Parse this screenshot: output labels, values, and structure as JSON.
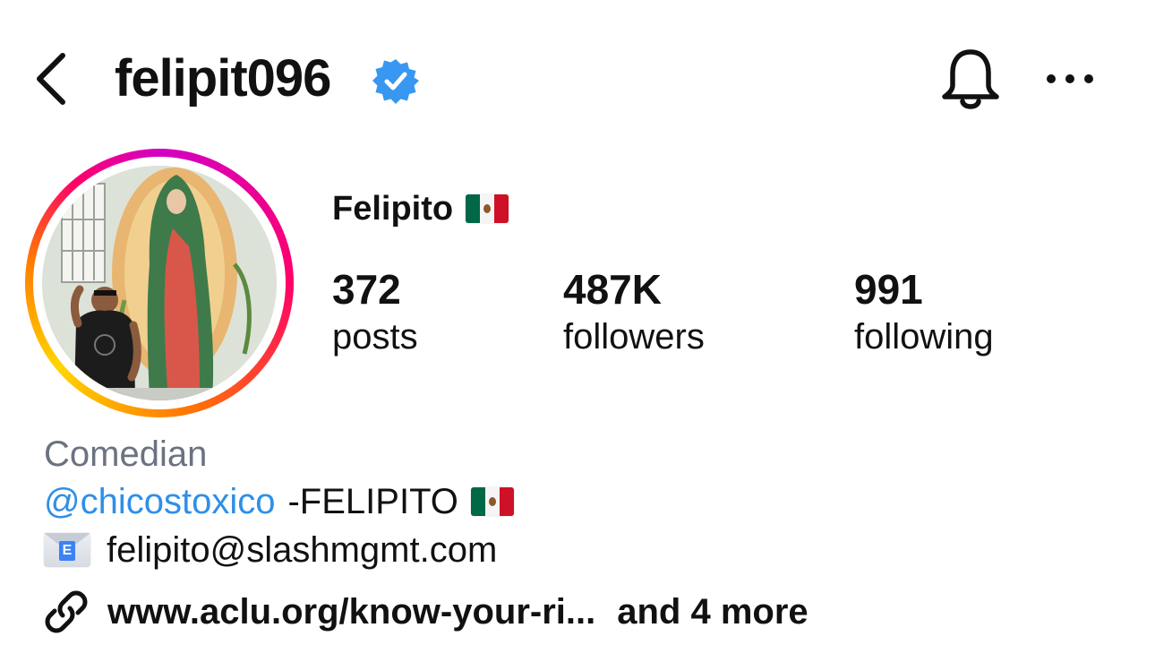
{
  "header": {
    "back_icon": "chevron-left-icon",
    "handle": "felipit096",
    "verified_icon": "verified-badge-icon",
    "verified_color": "#3897f0",
    "notifications_icon": "bell-icon",
    "more_icon": "ellipsis-icon"
  },
  "profile": {
    "avatar_has_story": true,
    "display_name": "Felipito",
    "flag_icon": "mexico-flag-icon"
  },
  "stats": [
    {
      "value": "372",
      "label": "posts"
    },
    {
      "value": "487K",
      "label": "followers"
    },
    {
      "value": "991",
      "label": "following"
    }
  ],
  "bio": {
    "category": "Comedian",
    "mention": "@chicostoxico",
    "mention_suffix": "-FELIPITO",
    "email_icon": "envelope-icon",
    "email": "felipito@slashmgmt.com",
    "link_icon": "link-icon",
    "link": "www.aclu.org/know-your-ri...",
    "more_links": "and 4 more"
  },
  "colors": {
    "mention": "#2f8fe8",
    "category": "#6b7280",
    "text": "#111111"
  }
}
